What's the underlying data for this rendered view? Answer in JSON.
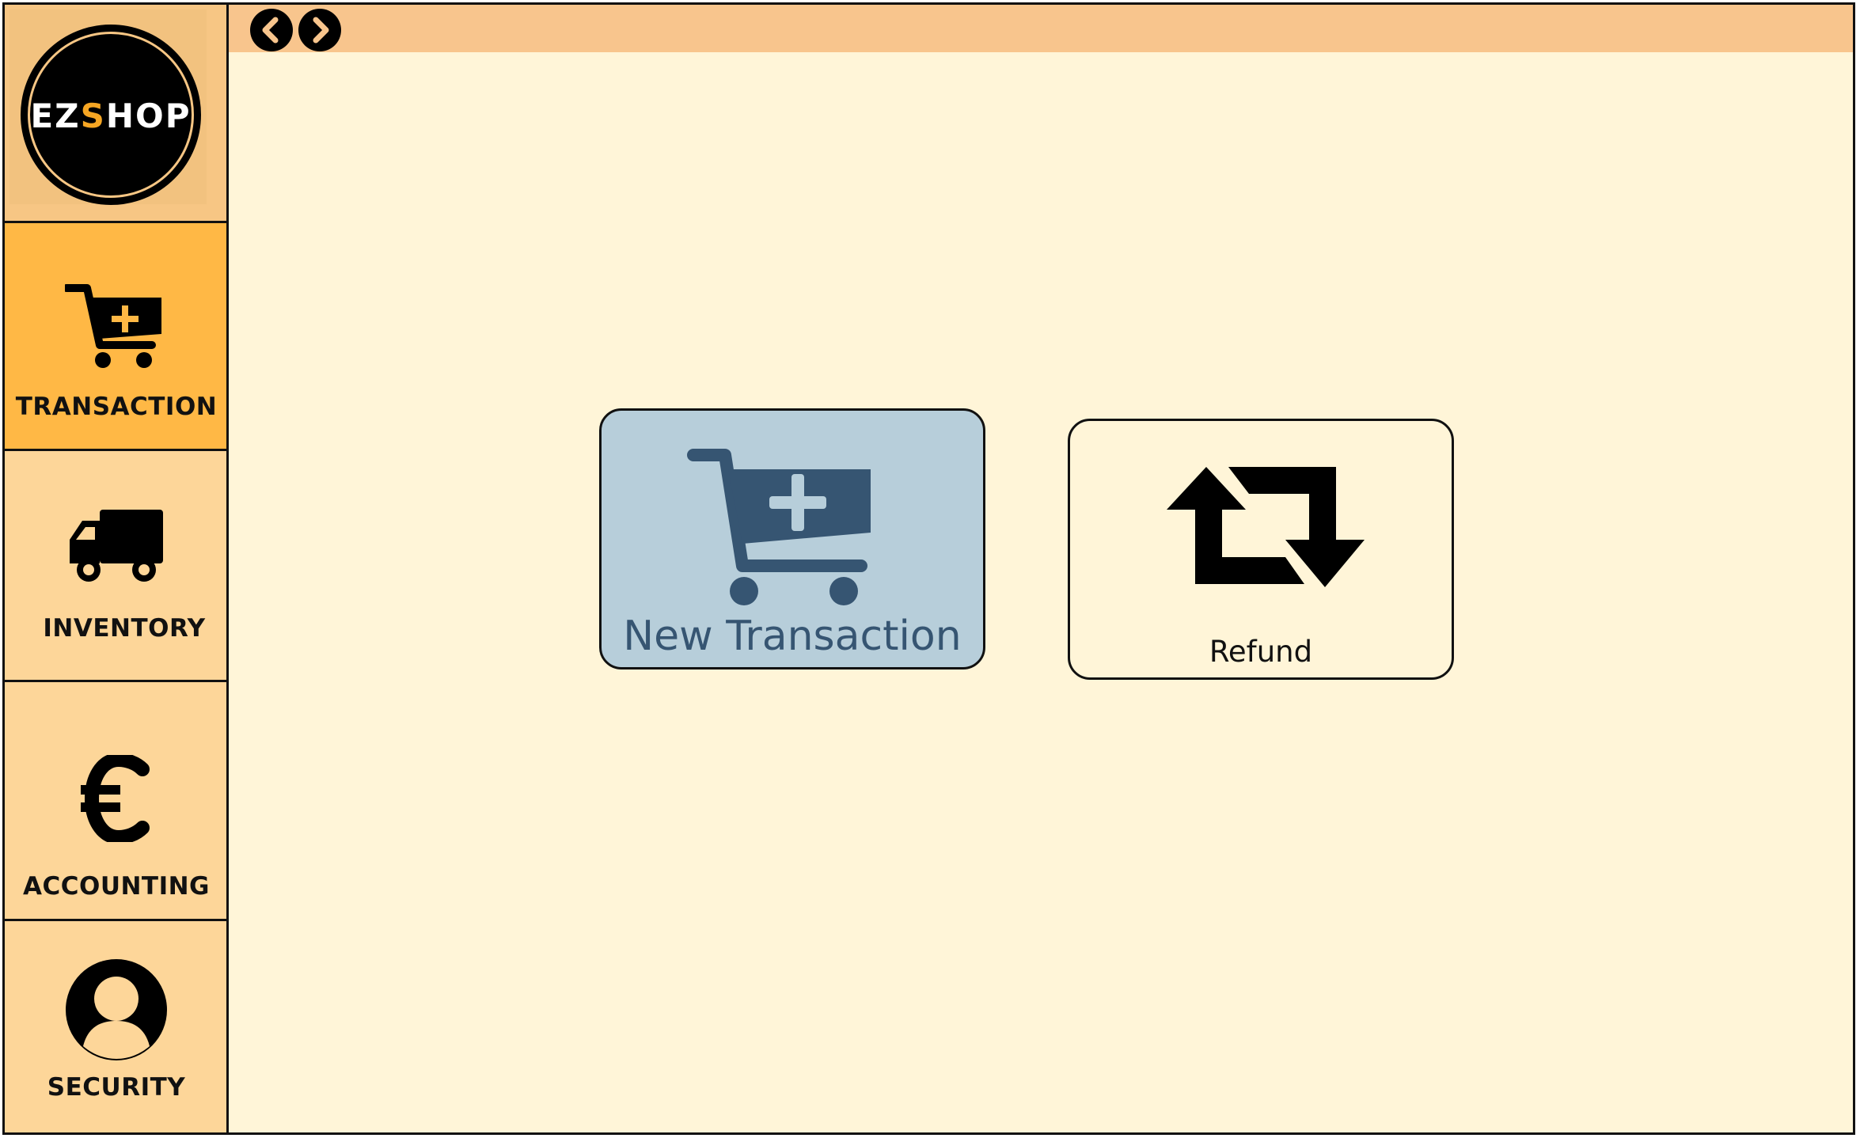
{
  "app": {
    "logo_text_prefix": "EZ",
    "logo_text_accent": "S",
    "logo_text_suffix": "HOP"
  },
  "sidebar": {
    "items": [
      {
        "label": "TRANSACTION",
        "icon": "cart-plus-icon",
        "active": true
      },
      {
        "label": "INVENTORY",
        "icon": "truck-icon",
        "active": false
      },
      {
        "label": "ACCOUNTING",
        "icon": "euro-icon",
        "active": false
      },
      {
        "label": "SECURITY",
        "icon": "user-circle-icon",
        "active": false
      }
    ]
  },
  "topbar": {
    "back_icon": "chevron-left-icon",
    "forward_icon": "chevron-right-icon"
  },
  "main": {
    "tiles": [
      {
        "label": "New Transaction",
        "icon": "cart-plus-icon",
        "selected": true
      },
      {
        "label": "Refund",
        "icon": "refund-arrows-icon",
        "selected": false
      }
    ]
  },
  "colors": {
    "sidebar_bg": "#fdd699",
    "active_item": "#ffb845",
    "topbar_bg": "#f8c58d",
    "main_bg": "#fff5d8",
    "selected_tile": "#b7ceda",
    "selected_tile_fg": "#365572",
    "logo_accent": "#f6a623"
  }
}
